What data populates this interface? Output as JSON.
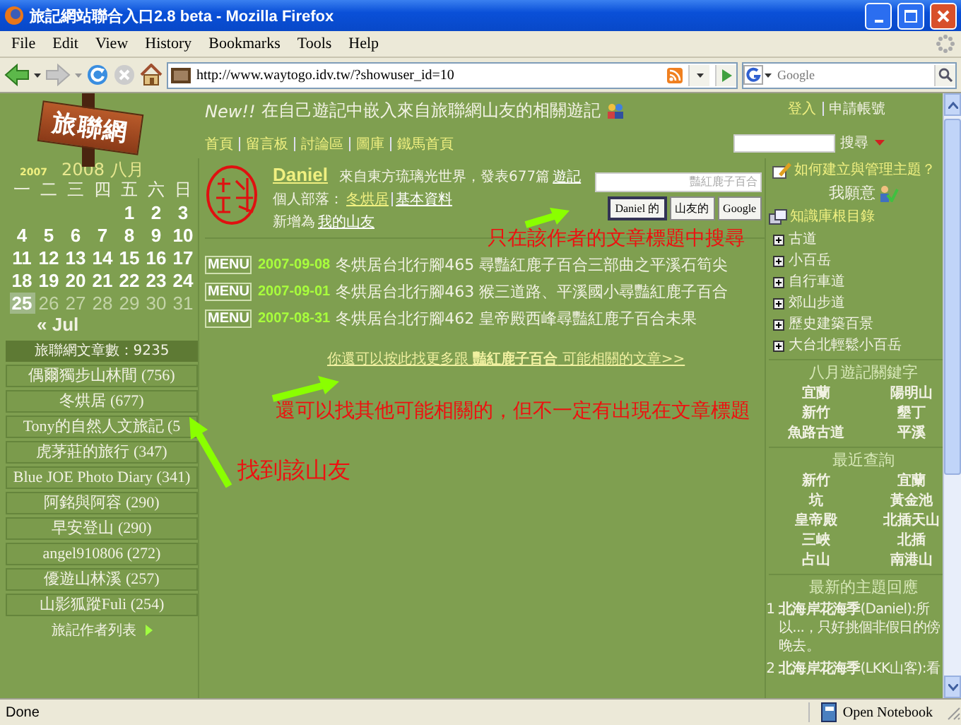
{
  "window": {
    "title": "旅記網站聯合入口2.8 beta - Mozilla Firefox"
  },
  "menu_bar": [
    "File",
    "Edit",
    "View",
    "History",
    "Bookmarks",
    "Tools",
    "Help"
  ],
  "toolbar": {
    "url": "http://www.waytogo.idv.tw/?showuser_id=10",
    "search_placeholder": "Google"
  },
  "site_header": {
    "logo": "旅聯網",
    "badge": "New!!",
    "announcement": "在自己遊記中嵌入來自旅聯網山友的相關遊記",
    "nav": [
      "首頁",
      "留言板",
      "討論區",
      "圖庫",
      "鐵馬首頁"
    ],
    "account": [
      "登入",
      "申請帳號"
    ],
    "search_button": "搜尋"
  },
  "calendar": {
    "prev_year": "2007",
    "month": "2008 八月",
    "weekdays": [
      "一",
      "二",
      "三",
      "四",
      "五",
      "六",
      "日"
    ],
    "weeks": [
      [
        {
          "day": "1",
          "linked": true,
          "selected": false
        },
        {
          "day": "2",
          "linked": true,
          "selected": false
        },
        {
          "day": "3",
          "linked": true,
          "selected": false
        }
      ],
      [
        {
          "day": "4",
          "linked": true,
          "selected": false
        },
        {
          "day": "5",
          "linked": true,
          "selected": false
        },
        {
          "day": "6",
          "linked": true,
          "selected": false
        },
        {
          "day": "7",
          "linked": true,
          "selected": false
        },
        {
          "day": "8",
          "linked": true,
          "selected": false
        },
        {
          "day": "9",
          "linked": true,
          "selected": false
        },
        {
          "day": "10",
          "linked": true,
          "selected": false
        }
      ],
      [
        {
          "day": "11",
          "linked": true,
          "selected": false
        },
        {
          "day": "12",
          "linked": true,
          "selected": false
        },
        {
          "day": "13",
          "linked": true,
          "selected": false
        },
        {
          "day": "14",
          "linked": true,
          "selected": false
        },
        {
          "day": "15",
          "linked": true,
          "selected": false
        },
        {
          "day": "16",
          "linked": true,
          "selected": false
        },
        {
          "day": "17",
          "linked": true,
          "selected": false
        }
      ],
      [
        {
          "day": "18",
          "linked": true,
          "selected": false
        },
        {
          "day": "19",
          "linked": true,
          "selected": false
        },
        {
          "day": "20",
          "linked": true,
          "selected": false
        },
        {
          "day": "21",
          "linked": true,
          "selected": false
        },
        {
          "day": "22",
          "linked": true,
          "selected": false
        },
        {
          "day": "23",
          "linked": true,
          "selected": false
        },
        {
          "day": "24",
          "linked": true,
          "selected": false
        }
      ],
      [
        {
          "day": "25",
          "linked": true,
          "selected": true
        },
        {
          "day": "26",
          "linked": false,
          "selected": false
        },
        {
          "day": "27",
          "linked": false,
          "selected": false
        },
        {
          "day": "28",
          "linked": false,
          "selected": false
        },
        {
          "day": "29",
          "linked": false,
          "selected": false
        },
        {
          "day": "30",
          "linked": false,
          "selected": false
        },
        {
          "day": "31",
          "linked": false,
          "selected": false
        }
      ]
    ],
    "prev_month": "« Jul"
  },
  "article_count": "旅聯網文章數：9235",
  "authors": [
    "偶爾獨步山林間 (756)",
    "冬烘居 (677)",
    "Tony的自然人文旅記 (5",
    "虎茅莊的旅行 (347)",
    "Blue JOE Photo Diary (341)",
    "阿銘與阿容 (290)",
    "早安登山 (290)",
    "angel910806 (272)",
    "優遊山林溪 (257)",
    "山影狐蹤Fuli (254)"
  ],
  "authors_link": "旅記作者列表",
  "profile": {
    "name": "Daniel",
    "intro": "來自東方琉璃光世界，發表677篇",
    "intro_link": "遊記",
    "blog_label": "個人部落：",
    "blog_link": "冬烘居",
    "profile_link": "基本資料",
    "add_label": "新增為",
    "add_link": "我的山友"
  },
  "title_search": {
    "value": "豔紅鹿子百合",
    "buttons": [
      "Daniel 的",
      "山友的",
      "Google"
    ]
  },
  "posts": [
    {
      "badge": "MENU",
      "date": "2007-09-08",
      "title": "冬烘居台北行腳465 尋豔紅鹿子百合三部曲之平溪石筍尖"
    },
    {
      "badge": "MENU",
      "date": "2007-09-01",
      "title": "冬烘居台北行腳463 猴三道路、平溪國小尋豔紅鹿子百合"
    },
    {
      "badge": "MENU",
      "date": "2007-08-31",
      "title": "冬烘居台北行腳462 皇帝殿西峰尋豔紅鹿子百合未果"
    }
  ],
  "more_link": "你還可以按此找更多跟 **豔紅鹿子百合** 可能相關的文章>>",
  "annotations": [
    "只在該作者的文章標題中搜尋",
    "還可以找其他可能相關的，但不一定有出現在文章標題",
    "找到該山友"
  ],
  "sidebar": {
    "help_link": "如何建立與管理主題？",
    "volunteer": "我願意",
    "knowledge_root": "知識庫根目錄",
    "knowledge_items": [
      {
        "label": "古道",
        "expanded": false
      },
      {
        "label": "小百岳",
        "expanded": false
      },
      {
        "label": "自行車道",
        "expanded": false
      },
      {
        "label": "郊山步道",
        "expanded": false
      },
      {
        "label": "歷史建築百景",
        "expanded": false
      },
      {
        "label": "大台北輕鬆小百岳",
        "expanded": false
      }
    ],
    "keywords_title": "八月遊記關鍵字",
    "keywords": [
      "宜蘭",
      "陽明山",
      "新竹",
      "墾丁",
      "魚路古道",
      "平溪"
    ],
    "recent_title": "最近查詢",
    "recent": [
      "新竹",
      "宜蘭",
      "坑",
      "黃金池",
      "皇帝殿",
      "北插天山",
      "三峽",
      "北插",
      "占山",
      "南港山"
    ],
    "replies_title": "最新的主題回應",
    "replies": [
      {
        "number": "1",
        "text": "**北海岸花海季**(Daniel):所以...，只好挑個非假日的傍晚去。"
      },
      {
        "number": "2",
        "text": "**北海岸花海季**(LKK山客):看"
      }
    ]
  },
  "status_bar": {
    "text": "Done",
    "notebook": "Open Notebook"
  }
}
